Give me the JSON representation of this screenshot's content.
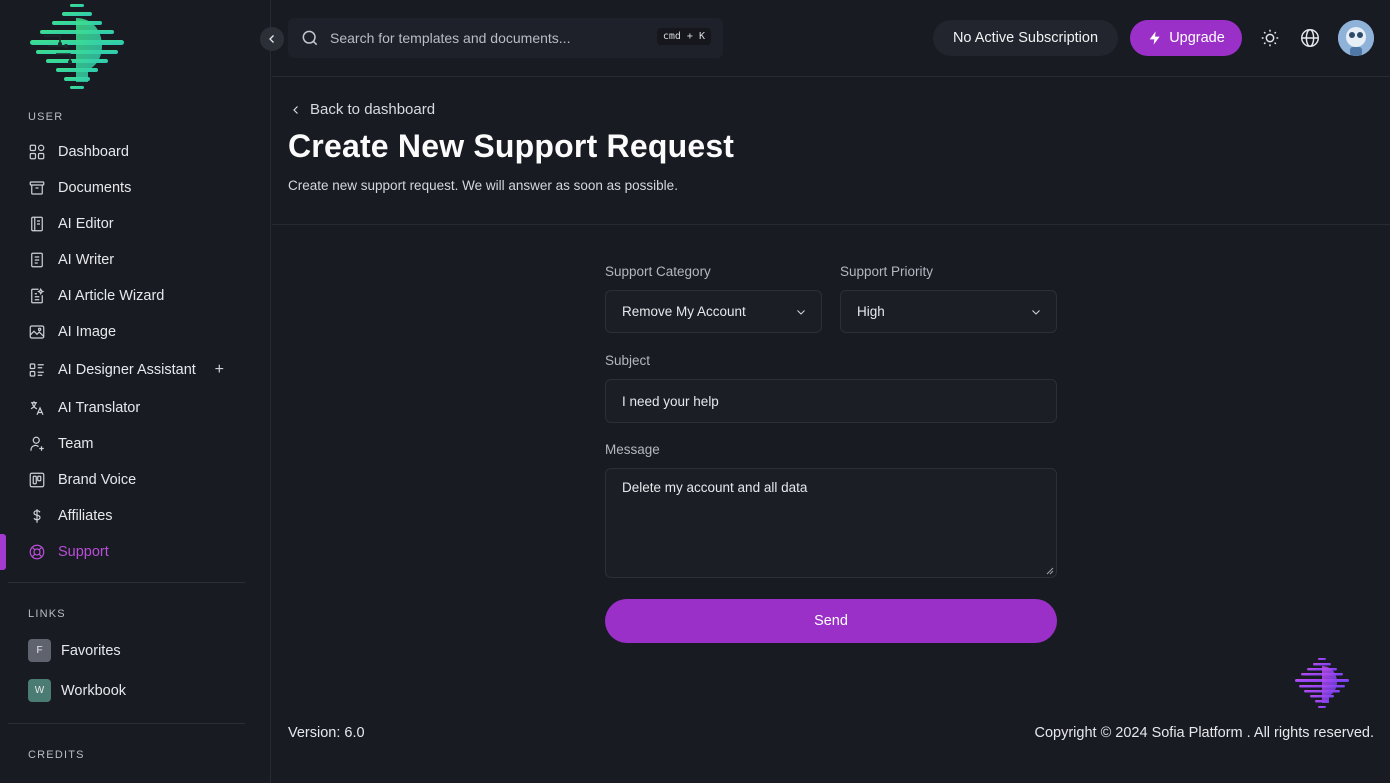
{
  "sidebar": {
    "user_label": "USER",
    "items": [
      {
        "label": "Dashboard",
        "icon": "grid-icon"
      },
      {
        "label": "Documents",
        "icon": "archive-icon"
      },
      {
        "label": "AI Editor",
        "icon": "notebook-icon"
      },
      {
        "label": "AI Writer",
        "icon": "document-icon"
      },
      {
        "label": "AI Article Wizard",
        "icon": "article-wizard-icon"
      },
      {
        "label": "AI Image",
        "icon": "image-icon"
      },
      {
        "label": "AI Designer Assistant",
        "icon": "layout-list-icon",
        "extra": "+"
      },
      {
        "label": "AI Translator",
        "icon": "translate-icon"
      },
      {
        "label": "Team",
        "icon": "user-plus-icon"
      },
      {
        "label": "Brand Voice",
        "icon": "brand-voice-icon"
      },
      {
        "label": "Affiliates",
        "icon": "dollar-icon"
      },
      {
        "label": "Support",
        "icon": "lifebuoy-icon",
        "active": true
      }
    ],
    "links_label": "LINKS",
    "links": [
      {
        "badge": "F",
        "label": "Favorites",
        "color": "#5f636e"
      },
      {
        "badge": "W",
        "label": "Workbook",
        "color": "#4a7c73"
      }
    ],
    "credits_label": "CREDITS"
  },
  "header": {
    "search_placeholder": "Search for templates and documents...",
    "shortcut": "cmd + K",
    "subscription": "No Active Subscription",
    "upgrade_label": "Upgrade"
  },
  "page": {
    "back_label": "Back to dashboard",
    "title": "Create New Support Request",
    "subtitle": "Create new support request. We will answer as soon as possible."
  },
  "form": {
    "category_label": "Support Category",
    "category_value": "Remove My Account",
    "priority_label": "Support Priority",
    "priority_value": "High",
    "subject_label": "Subject",
    "subject_value": "I need your help",
    "message_label": "Message",
    "message_value": "Delete my account and all data",
    "send_label": "Send"
  },
  "footer": {
    "version": "Version: 6.0",
    "copyright": "Copyright © 2024 Sofia Platform . All rights reserved."
  },
  "colors": {
    "accent": "#9b30c9",
    "active_text": "#b84fd8",
    "background": "#181b22"
  }
}
